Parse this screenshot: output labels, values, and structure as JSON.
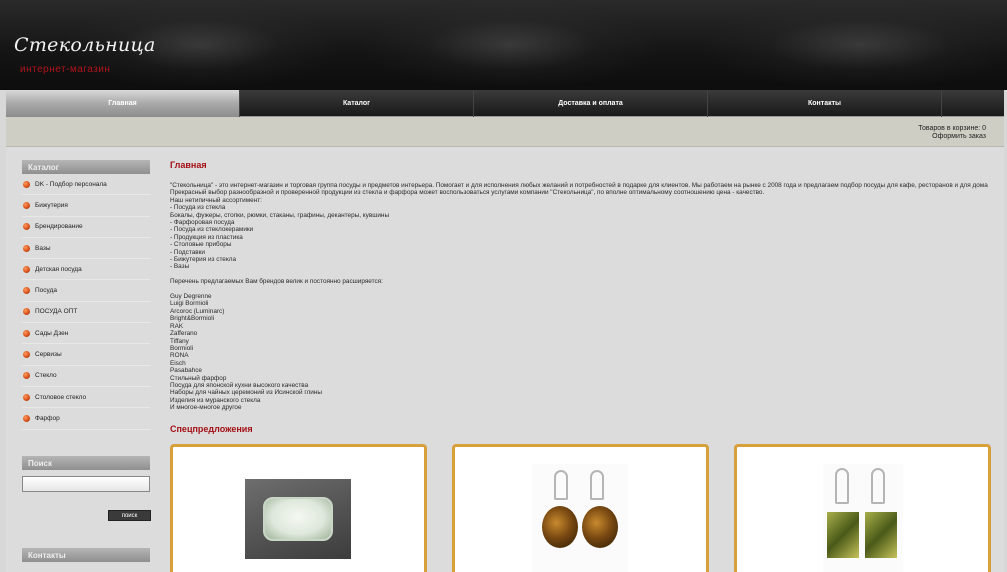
{
  "header": {
    "logo_title": "Стекольница",
    "logo_subtitle": "интернет-магазин"
  },
  "nav": {
    "items": [
      {
        "label": "Главная",
        "active": true
      },
      {
        "label": "Каталог",
        "active": false
      },
      {
        "label": "Доставка и оплата",
        "active": false
      },
      {
        "label": "Контакты",
        "active": false
      }
    ]
  },
  "cart": {
    "count_text": "Товаров в корзине: 0",
    "order_text": "Оформить заказ"
  },
  "sidebar": {
    "catalog_title": "Каталог",
    "categories": [
      "DK - Подбор персонала",
      "Бижутерия",
      "Брендирование",
      "Вазы",
      "Детская посуда",
      "Посуда",
      "ПОСУДА ОПТ",
      "Сады Дзен",
      "Сервизы",
      "Стекло",
      "Столовое стекло",
      "Фарфор"
    ],
    "search_title": "Поиск",
    "search_button": "поиск",
    "contacts_title": "Контакты"
  },
  "content": {
    "title": "Главная",
    "lines": [
      "\"Стекольница\" - это интернет-магазин и торговая группа посуды и предметов интерьера. Помогает и для исполнения любых желаний и потребностей в подарке для клиентов. Мы работаем на рынке с 2008 года и предлагаем подбор посуды для кафе, ресторанов и для дома",
      "Прекрасный выбор разнообразной и проверенной продукции из стекла и фарфора может воспользоваться услугами компании \"Стекольница\", по вполне оптимальному соотношению цена - качество.",
      "Наш нетипичный ассортимент:",
      "- Посуда из стекла",
      "Бокалы, фужеры, стопки, рюмки, стаканы, графины, декантеры, кувшины",
      "- Фарфоровая посуда",
      "- Посуда из стеклокерамики",
      "- Продукция из пластика",
      "- Столовые приборы",
      "- Подставки",
      "- Бижутерия из стекла",
      "- Вазы",
      "",
      "Перечень предлагаемых Вам брендов велик и постоянно расширяется:",
      "",
      "Guy Degrenne",
      "Luigi Bormioli",
      "Arcoroc (Luminarc)",
      "Bright&Bormioli",
      "RAK",
      "Zafferano",
      "Tiffany",
      "Bormioli",
      "RONA",
      "Eisch",
      "Pasabahce",
      "Стильный фарфор",
      "Посуда для японской кухни высокого качества",
      "Наборы для чайных церемоний из Исинской глины",
      "Изделия из муранского стекла",
      "И многое-многое другое"
    ],
    "special_title": "Спецпредложения"
  }
}
